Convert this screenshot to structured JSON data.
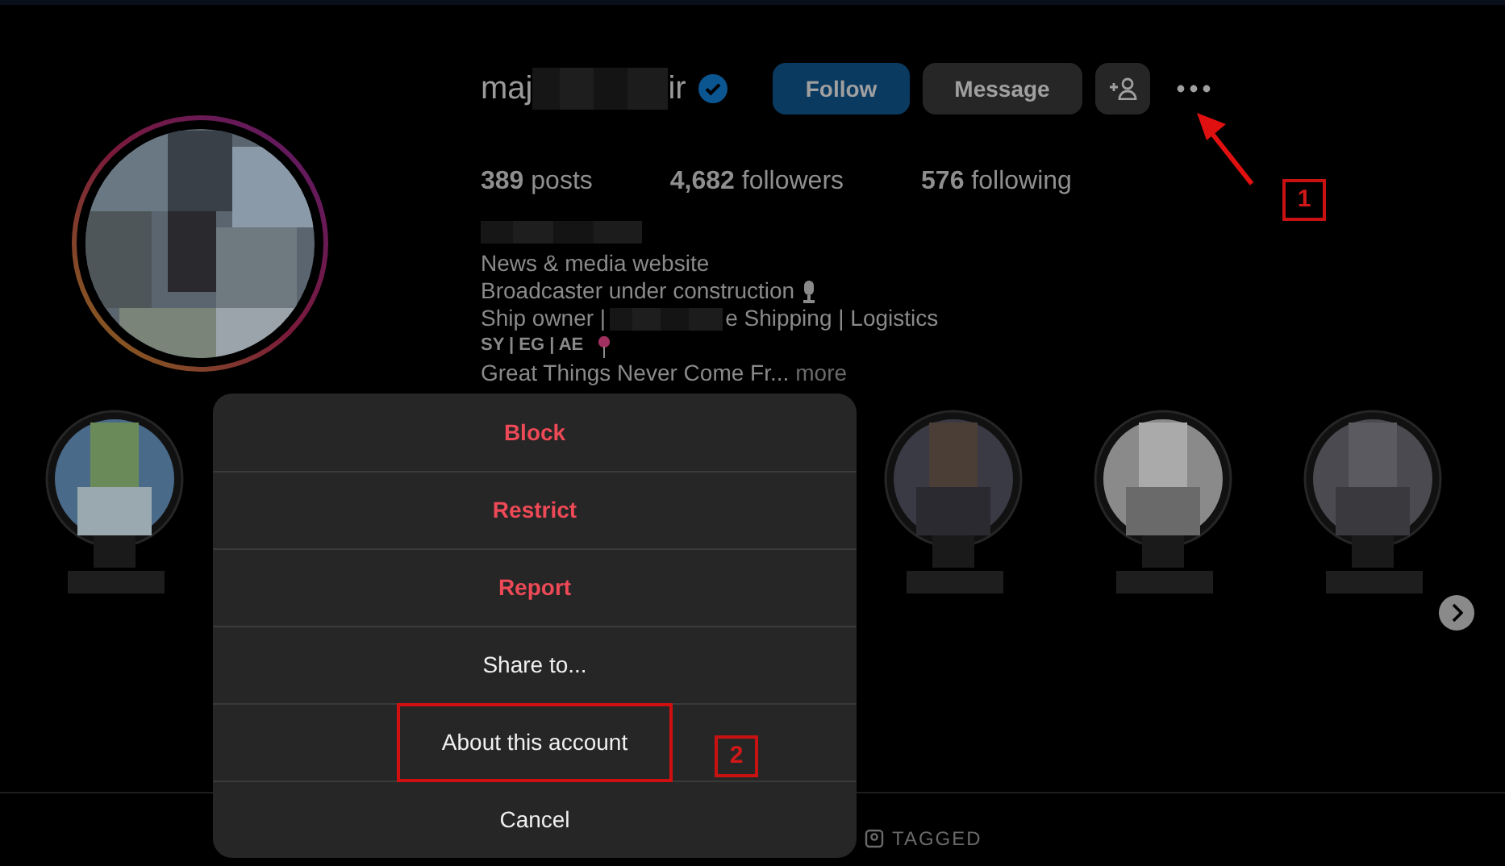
{
  "profile": {
    "username_start": "maj",
    "username_end": "ir",
    "verified": true,
    "buttons": [
      {
        "label": "Follow",
        "kind": "primary"
      },
      {
        "label": "Message",
        "kind": "secondary"
      }
    ],
    "stats": [
      {
        "count": "389",
        "label": "posts"
      },
      {
        "count": "4,682",
        "label": "followers"
      },
      {
        "count": "576",
        "label": "following"
      }
    ],
    "bio": [
      {
        "kind": "category",
        "text": "News & media website"
      },
      {
        "kind": "mic",
        "text": "Broadcaster under construction"
      },
      {
        "kind": "redacted",
        "before": "Ship owner |",
        "after": "e Shipping | Logistics"
      },
      {
        "kind": "pin",
        "text": "SY | EG | AE"
      },
      {
        "kind": "more",
        "text": "Great Things Never Come Fr...",
        "link": "more"
      }
    ]
  },
  "tabs": [
    {
      "label": "TAGGED",
      "selected": false
    }
  ],
  "menu": {
    "items": [
      {
        "label": "Block",
        "kind": "danger",
        "highlighted": false
      },
      {
        "label": "Restrict",
        "kind": "danger",
        "highlighted": false
      },
      {
        "label": "Report",
        "kind": "danger",
        "highlighted": false
      },
      {
        "label": "Share to...",
        "kind": "normal",
        "highlighted": false
      },
      {
        "label": "About this account",
        "kind": "normal",
        "highlighted": true
      },
      {
        "label": "Cancel",
        "kind": "normal",
        "highlighted": false
      }
    ]
  },
  "annotations": [
    {
      "number": "1"
    },
    {
      "number": "2"
    }
  ]
}
